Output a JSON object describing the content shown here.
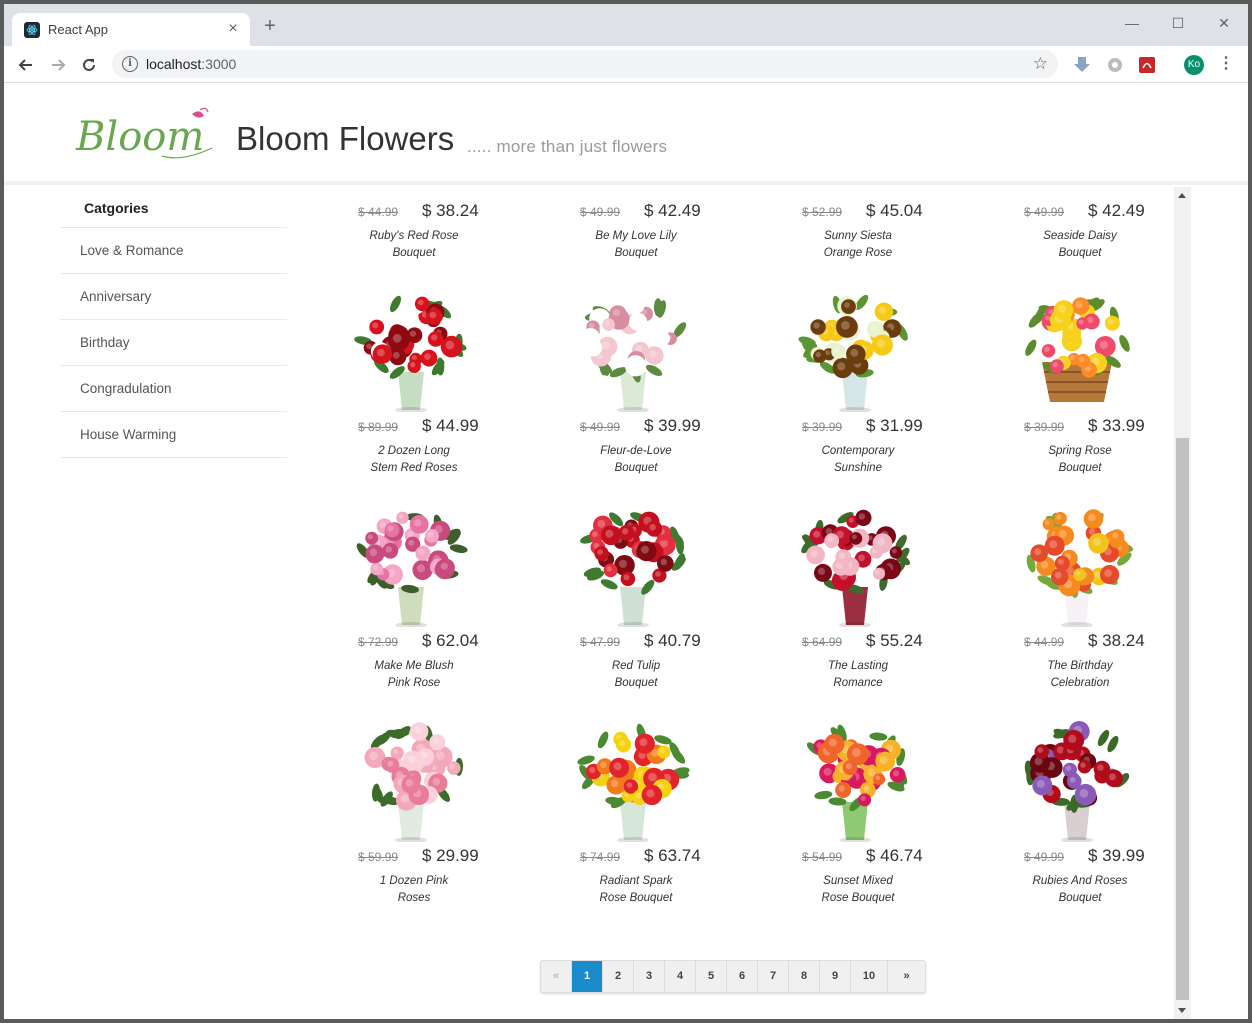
{
  "browser": {
    "tab_title": "React App",
    "tab_close": "×",
    "new_tab": "+",
    "window_controls": {
      "minimize": "—",
      "maximize": "☐",
      "close": "✕"
    },
    "url_host": "localhost",
    "url_port": ":3000",
    "profile_initials": "Ko",
    "icons": [
      "back-arrow-icon",
      "forward-arrow-icon",
      "reload-icon",
      "info-icon",
      "star-icon",
      "download-extension-icon",
      "settings-extension-icon",
      "pdf-extension-icon",
      "menu-icon"
    ]
  },
  "header": {
    "logo_text": "Bloom",
    "brand": "Bloom Flowers",
    "tagline": "..... more than just flowers"
  },
  "sidebar": {
    "heading": "Catgories",
    "items": [
      "Love & Romance",
      "Anniversary",
      "Birthday",
      "Congradulation",
      "House Warming"
    ]
  },
  "products": [
    {
      "old": "$ 44.99",
      "price": "$ 38.24",
      "name1": "Ruby's Red Rose",
      "name2": "Bouquet",
      "img": "none"
    },
    {
      "old": "$ 49.99",
      "price": "$ 42.49",
      "name1": "Be My Love Lily",
      "name2": "Bouquet",
      "img": "none"
    },
    {
      "old": "$ 52.99",
      "price": "$ 45.04",
      "name1": "Sunny Siesta",
      "name2": "Orange Rose",
      "img": "none"
    },
    {
      "old": "$ 49.99",
      "price": "$ 42.49",
      "name1": "Seaside Daisy",
      "name2": "Bouquet",
      "img": "none"
    },
    {
      "old": "$ 89.99",
      "price": "$ 44.99",
      "name1": "2 Dozen Long",
      "name2": "Stem Red Roses",
      "img": "red-roses"
    },
    {
      "old": "$ 49.99",
      "price": "$ 39.99",
      "name1": "Fleur-de-Love",
      "name2": "Bouquet",
      "img": "pink-lilies"
    },
    {
      "old": "$ 39.99",
      "price": "$ 31.99",
      "name1": "Contemporary",
      "name2": "Sunshine",
      "img": "sunflower"
    },
    {
      "old": "$ 39.99",
      "price": "$ 33.99",
      "name1": "Spring Rose",
      "name2": "Bouquet",
      "img": "basket-roses"
    },
    {
      "old": "$ 72.99",
      "price": "$ 62.04",
      "name1": "Make Me Blush",
      "name2": "Pink Rose",
      "img": "pink-roses"
    },
    {
      "old": "$ 47.99",
      "price": "$ 40.79",
      "name1": "Red Tulip",
      "name2": "Bouquet",
      "img": "red-tulips"
    },
    {
      "old": "$ 64.99",
      "price": "$ 55.24",
      "name1": "The Lasting",
      "name2": "Romance",
      "img": "lily-rose"
    },
    {
      "old": "$ 44.99",
      "price": "$ 38.24",
      "name1": "The Birthday",
      "name2": "Celebration",
      "img": "birthday"
    },
    {
      "old": "$ 59.99",
      "price": "$ 29.99",
      "name1": "1 Dozen Pink",
      "name2": "Roses",
      "img": "light-pink-roses"
    },
    {
      "old": "$ 74.99",
      "price": "$ 63.74",
      "name1": "Radiant Spark",
      "name2": "Rose Bouquet",
      "img": "mixed-roses"
    },
    {
      "old": "$ 54.99",
      "price": "$ 46.74",
      "name1": "Sunset Mixed",
      "name2": "Rose Bouquet",
      "img": "sunset-roses"
    },
    {
      "old": "$ 49.99",
      "price": "$ 39.99",
      "name1": "Rubies And Roses",
      "name2": "Bouquet",
      "img": "rubies-roses"
    }
  ],
  "pagination": {
    "prev": "«",
    "pages": [
      "1",
      "2",
      "3",
      "4",
      "5",
      "6",
      "7",
      "8",
      "9",
      "10"
    ],
    "active": "1",
    "next": "»"
  },
  "colors": {
    "accent": "#1a8bcb",
    "logo_green": "#6aa84f",
    "logo_pink": "#d94e8f"
  }
}
